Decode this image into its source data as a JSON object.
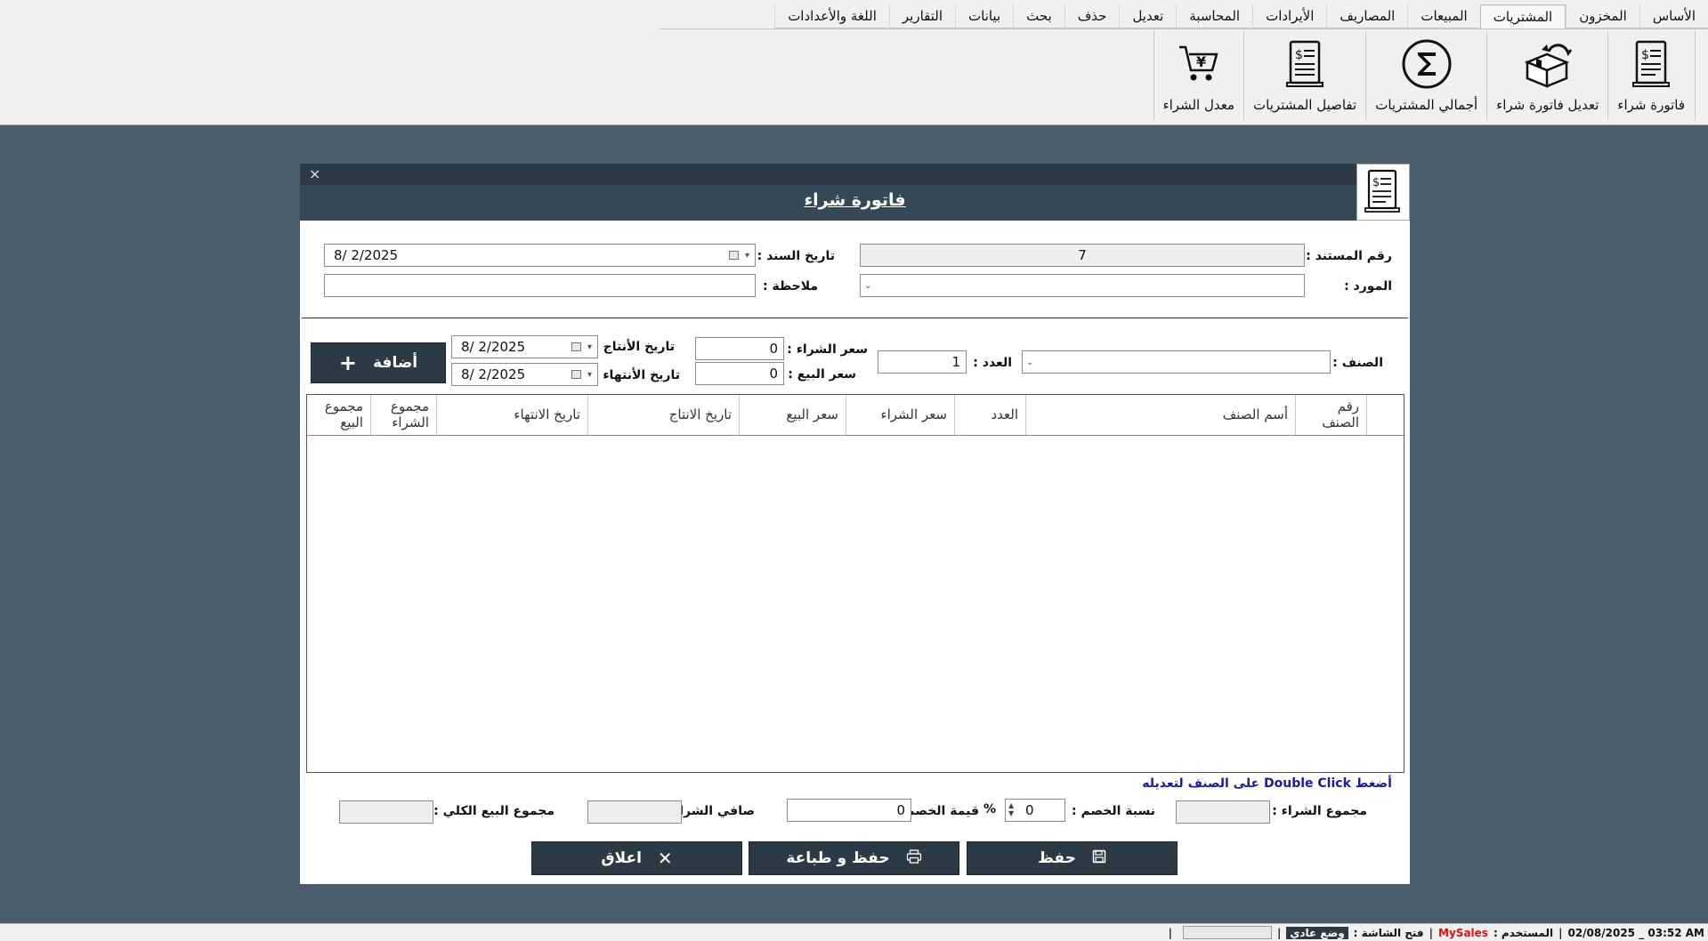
{
  "ribbon": {
    "tabs": [
      {
        "label": "الأساس",
        "active": false
      },
      {
        "label": "المخزون",
        "active": false
      },
      {
        "label": "المشتريات",
        "active": true
      },
      {
        "label": "المبيعات",
        "active": false
      },
      {
        "label": "المصاريف",
        "active": false
      },
      {
        "label": "الأيرادات",
        "active": false
      },
      {
        "label": "المحاسبة",
        "active": false
      },
      {
        "label": "تعديل",
        "active": false
      },
      {
        "label": "حذف",
        "active": false
      },
      {
        "label": "بحث",
        "active": false
      },
      {
        "label": "بيانات",
        "active": false
      },
      {
        "label": "التقارير",
        "active": false
      },
      {
        "label": "اللغة والأعدادات",
        "active": false
      }
    ],
    "buttons": [
      {
        "label": "فاتورة شراء",
        "icon": "invoice-icon"
      },
      {
        "label": "تعديل فاتورة شراء",
        "icon": "box-return-icon"
      },
      {
        "label": "أجمالي المشتريات",
        "icon": "sigma-icon"
      },
      {
        "label": "تفاصيل المشتريات",
        "icon": "receipt-dollar-icon"
      },
      {
        "label": "معدل الشراء",
        "icon": "cart-yen-icon"
      }
    ]
  },
  "dialog": {
    "close_glyph": "×",
    "title": "فاتورة شراء",
    "doc_number_label": "رقم المستند :",
    "doc_number_value": "7",
    "doc_date_label": "تاريخ السند :",
    "doc_date_value": "8/  2/2025",
    "supplier_label": "المورد :",
    "supplier_value": "",
    "note_label": "ملاحظة :",
    "note_value": "",
    "item_label": "الصنف :",
    "item_value": "",
    "qty_label": "العدد :",
    "qty_value": "1",
    "purchase_price_label": "سعر الشراء :",
    "purchase_price_value": "0",
    "sale_price_label": "سعر البيع :",
    "sale_price_value": "0",
    "production_date_label": "تاريخ الأنتاج :",
    "production_date_value": "8/  2/2025",
    "expiry_date_label": "تاريخ الأنتهاء :",
    "expiry_date_value": "8/  2/2025",
    "add_button_label": "أضافة",
    "add_button_glyph": "+",
    "grid_columns": [
      "رقم الصنف",
      "أسم الصنف",
      "العدد",
      "سعر الشراء",
      "سعر البيع",
      "تاريخ الانتاج",
      "تاريخ الانتهاء",
      "مجموع الشراء",
      "مجموع البيع"
    ],
    "hint": "أضغط Double Click على الصنف لتعديله",
    "total_purchase_label": "مجموع الشراء :",
    "total_purchase_value": "",
    "discount_rate_label": "نسبة الخصم :",
    "discount_rate_value": "0",
    "percent_symbol": "%",
    "discount_value_label": "قيمة الخصم :",
    "discount_value_value": "0",
    "net_purchase_label": "صافي الشراء :",
    "net_purchase_value": "",
    "total_sale_label": "مجموع البيع الكلي :",
    "total_sale_value": "",
    "save_label": "حفظ",
    "save_print_label": "حفظ و طباعة",
    "close_label": "اعلاق",
    "close_btn_glyph": "✕"
  },
  "status": {
    "datetime": "02/08/2025 _ 03:52 AM",
    "user_label": "المستخدم :",
    "app_name": "MySales",
    "screen_label": "فتح الشاشة :",
    "mode": "وضع عادي",
    "sep": "|"
  },
  "colors": {
    "background": "#4b5d6a",
    "dark": "#2b3a45",
    "header": "#354855",
    "hint": "#1a1aa5",
    "app_name": "#dd1111"
  }
}
